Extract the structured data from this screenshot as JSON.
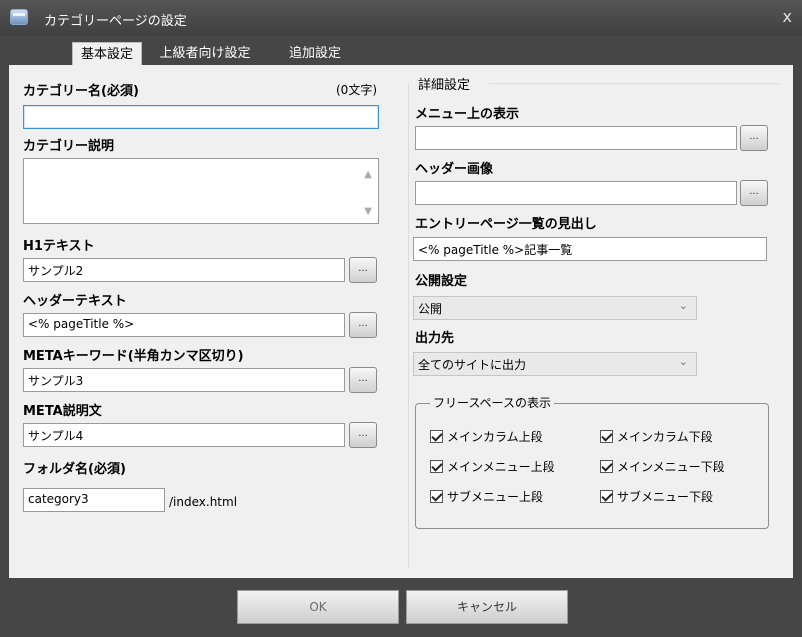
{
  "window": {
    "title": "カテゴリーページの設定",
    "close": "x"
  },
  "tabs": [
    {
      "label": "基本設定"
    },
    {
      "label": "上級者向け設定"
    },
    {
      "label": "追加設定"
    }
  ],
  "left": {
    "category_name_label": "カテゴリー名(必須)",
    "char_count": "(0文字)",
    "category_name_value": "",
    "category_desc_label": "カテゴリー説明",
    "category_desc_value": "",
    "h1_label": "H1テキスト",
    "h1_value": "サンプル2",
    "header_label": "ヘッダーテキスト",
    "header_value": "<% pageTitle %>",
    "meta_kw_label": "METAキーワード(半角カンマ区切り)",
    "meta_kw_value": "サンプル3",
    "meta_desc_label": "META説明文",
    "meta_desc_value": "サンプル4",
    "folder_label": "フォルダ名(必須)",
    "folder_value": "category3",
    "folder_suffix": "/index.html",
    "dots": "..."
  },
  "right": {
    "section_title": "詳細設定",
    "menu_label": "メニュー上の表示",
    "menu_value": "",
    "header_img_label": "ヘッダー画像",
    "header_img_value": "",
    "entry_heading_label": "エントリーページ一覧の見出し",
    "entry_heading_value": "<% pageTitle %>記事一覧",
    "publish_label": "公開設定",
    "publish_value": "公開",
    "output_label": "出力先",
    "output_value": "全てのサイトに出力",
    "freespace_title": "フリースペースの表示",
    "checkboxes": [
      {
        "label": "メインカラム上段"
      },
      {
        "label": "メインカラム下段"
      },
      {
        "label": "メインメニュー上段"
      },
      {
        "label": "メインメニュー下段"
      },
      {
        "label": "サブメニュー上段"
      },
      {
        "label": "サブメニュー下段"
      }
    ]
  },
  "footer": {
    "ok": "OK",
    "cancel": "キャンセル"
  }
}
